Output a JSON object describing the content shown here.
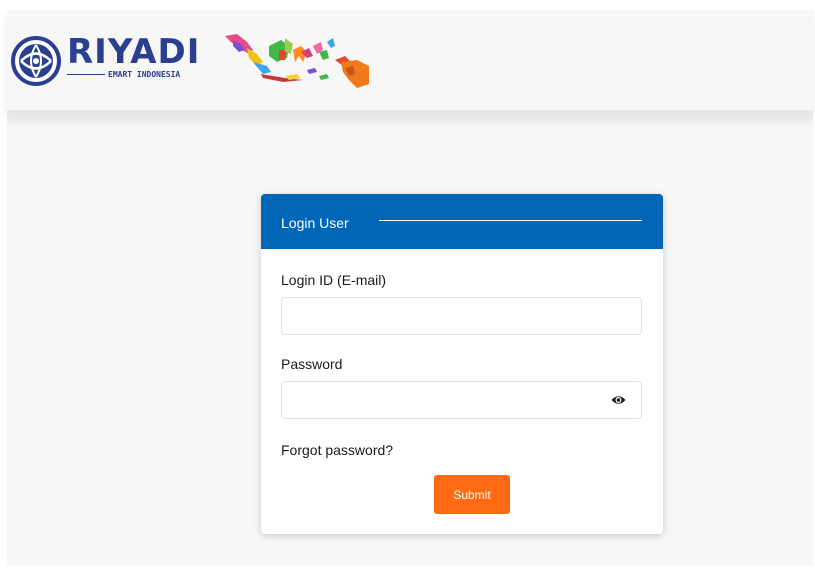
{
  "brand": {
    "name": "RIYADI",
    "subtitle": "EMART INDONESIA",
    "color": "#2a3f8f"
  },
  "icons": {
    "logo": "globe-emblem-icon",
    "map": "indonesia-map-icon",
    "password_toggle": "eye-icon"
  },
  "login": {
    "title": "Login User",
    "header_color": "#0067b8",
    "email_label": "Login ID (E-mail)",
    "email_value": "",
    "password_label": "Password",
    "password_value": "",
    "forgot_label": "Forgot password?",
    "submit_label": "Submit",
    "submit_color": "#ff6a13"
  }
}
